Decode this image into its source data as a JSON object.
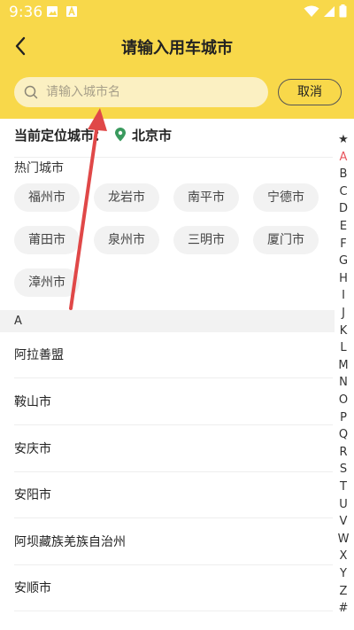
{
  "status": {
    "time": "9:36"
  },
  "header": {
    "title": "请输入用车城市",
    "back_icon": "back-arrow-icon"
  },
  "search": {
    "placeholder": "请输入城市名",
    "value": "",
    "cancel_label": "取消"
  },
  "location": {
    "label": "当前定位城市：",
    "city": "北京市",
    "pin_color": "#3a9a5e"
  },
  "hot": {
    "label": "热门城市",
    "cities": [
      "福州市",
      "龙岩市",
      "南平市",
      "宁德市",
      "莆田市",
      "泉州市",
      "三明市",
      "厦门市",
      "漳州市"
    ]
  },
  "list": {
    "section": "A",
    "cities": [
      "阿拉善盟",
      "鞍山市",
      "安庆市",
      "安阳市",
      "阿坝藏族羌族自治州",
      "安顺市"
    ]
  },
  "index": {
    "letters": [
      "★",
      "A",
      "B",
      "C",
      "D",
      "E",
      "F",
      "G",
      "H",
      "I",
      "J",
      "K",
      "L",
      "M",
      "N",
      "O",
      "P",
      "Q",
      "R",
      "S",
      "T",
      "U",
      "V",
      "W",
      "X",
      "Y",
      "Z",
      "#"
    ],
    "active": "A",
    "active_color": "#e8545c"
  },
  "colors": {
    "header_bg": "#f8d84a",
    "annotation_arrow": "#e04848"
  }
}
